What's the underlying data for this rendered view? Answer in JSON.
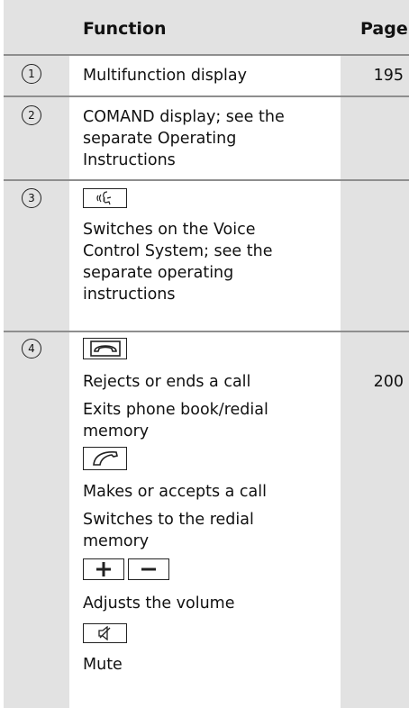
{
  "header": {
    "function": "Function",
    "page": "Page"
  },
  "rows": [
    {
      "num": "1",
      "lines": [
        "Multifunction display"
      ],
      "page": "195"
    },
    {
      "num": "2",
      "lines": [
        "COMAND display; see the",
        "separate Operating",
        "Instructions"
      ],
      "page": ""
    },
    {
      "num": "3",
      "button_icon": "voice-control-icon",
      "lines": [
        "Switches on the Voice",
        "Control System; see the",
        "separate operating",
        "instructions"
      ],
      "page": ""
    },
    {
      "num": "4",
      "items": [
        {
          "button_icon": "end-call-icon"
        },
        {
          "text": "Rejects or ends a call",
          "page": "200"
        },
        {
          "text_lines": [
            "Exits phone book/redial",
            "memory"
          ]
        },
        {
          "button_icon": "accept-call-icon"
        },
        {
          "text": "Makes or accepts a call"
        },
        {
          "text_lines": [
            "Switches to the redial",
            "memory"
          ]
        },
        {
          "button_icons": [
            "plus-icon",
            "minus-icon"
          ]
        },
        {
          "text": "Adjusts the volume"
        },
        {
          "button_icon": "mute-icon"
        },
        {
          "text": "Mute"
        }
      ]
    }
  ],
  "circled_digits": [
    "①",
    "②",
    "③",
    "④"
  ]
}
